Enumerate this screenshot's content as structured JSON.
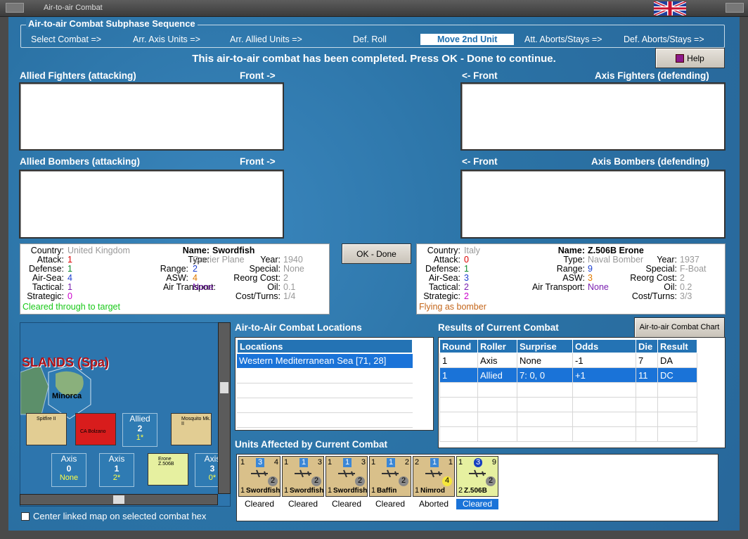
{
  "window": {
    "title": "Air-to-air Combat"
  },
  "subphase": {
    "title": "Air-to-air Combat Subphase Sequence",
    "phases": [
      "Select Combat =>",
      "Arr. Axis Units =>",
      "Arr. Allied Units =>",
      "Def. Roll",
      "Move 2nd Unit",
      "Att. Aborts/Stays =>",
      "Def. Aborts/Stays =>"
    ],
    "active_index": 4
  },
  "status_message": "This air-to-air combat has been completed.  Press OK - Done to continue.",
  "help_label": "Help",
  "panels": {
    "allied_fighters": {
      "label": "Allied Fighters (attacking)",
      "front": "Front ->"
    },
    "axis_fighters": {
      "label": "Axis Fighters (defending)",
      "front": "<- Front"
    },
    "allied_bombers": {
      "label": "Allied Bombers (attacking)",
      "front": "Front ->"
    },
    "axis_bombers": {
      "label": "Axis Bombers (defending)",
      "front": "<- Front"
    }
  },
  "ok_label": "OK - Done",
  "allied_unit": {
    "country_label": "Country:",
    "country": "United Kingdom",
    "name_label": "Name:",
    "name": "Swordfish",
    "attack_label": "Attack:",
    "attack": "1",
    "defense_label": "Defense:",
    "defense": "1",
    "airsea_label": "Air-Sea:",
    "airsea": "4",
    "tactical_label": "Tactical:",
    "tactical": "1",
    "strategic_label": "Strategic:",
    "strategic": "0",
    "type_label": "Type:",
    "type": "Carrier Plane",
    "year_label": "Year:",
    "year": "1940",
    "range_label": "Range:",
    "range": "2",
    "special_label": "Special:",
    "special": "None",
    "asw_label": "ASW:",
    "asw": "4",
    "reorg_label": "Reorg Cost:",
    "reorg": "2",
    "transport_label": "Air Transport:",
    "transport": "None",
    "oil_label": "Oil:",
    "oil": "0.1",
    "cost_label": "Cost/Turns:",
    "cost": "1/4",
    "status": "Cleared through to target"
  },
  "axis_unit": {
    "country_label": "Country:",
    "country": "Italy",
    "name_label": "Name:",
    "name": "Z.506B Erone",
    "attack_label": "Attack:",
    "attack": "0",
    "defense_label": "Defense:",
    "defense": "1",
    "airsea_label": "Air-Sea:",
    "airsea": "3",
    "tactical_label": "Tactical:",
    "tactical": "2",
    "strategic_label": "Strategic:",
    "strategic": "2",
    "type_label": "Type:",
    "type": "Naval Bomber",
    "year_label": "Year:",
    "year": "1937",
    "range_label": "Range:",
    "range": "9",
    "special_label": "Special:",
    "special": "F-Boat",
    "asw_label": "ASW:",
    "asw": "3",
    "reorg_label": "Reorg Cost:",
    "reorg": "2",
    "transport_label": "Air Transport:",
    "transport": "None",
    "oil_label": "Oil:",
    "oil": "0.2",
    "cost_label": "Cost/Turns:",
    "cost": "3/3",
    "status": "Flying as bomber"
  },
  "map": {
    "region_label": "SLANDS (Spa)",
    "hex_label": "Minorca",
    "boxes": [
      {
        "title": "Allied",
        "value": "2",
        "sub": "1*"
      },
      {
        "title": "Axis",
        "value": "0",
        "sub": "None"
      },
      {
        "title": "Axis",
        "value": "1",
        "sub": "2*"
      },
      {
        "title": "Axis",
        "value": "3",
        "sub": "0*"
      }
    ],
    "counter_names": [
      "Spitfire II",
      "CA Bolzano",
      "Mosquito Mk. II",
      "Erone Z.506B"
    ],
    "center_checkbox_label": "Center linked map on selected combat hex"
  },
  "locations": {
    "title": "Air-to-Air Combat Locations",
    "header": "Locations",
    "rows": [
      "Western Mediterranean Sea [71, 28]"
    ]
  },
  "results": {
    "title": "Results of Current Combat",
    "chart_button": "Air-to-air Combat Chart",
    "columns": [
      "Round",
      "Roller",
      "Surprise",
      "Odds",
      "Die",
      "Result"
    ],
    "rows": [
      [
        "1",
        "Axis",
        "None",
        "-1",
        "7",
        "DA"
      ],
      [
        "1",
        "Allied",
        "7: 0, 0",
        "+1",
        "11",
        "DC"
      ]
    ]
  },
  "affected": {
    "title": "Units Affected by Current Combat",
    "units": [
      {
        "name": "Swordfish",
        "status": "Cleared",
        "top": "3",
        "tl": "1",
        "tr": "4",
        "bl": "1",
        "br": "2"
      },
      {
        "name": "Swordfish",
        "status": "Cleared",
        "top": "1",
        "tl": "1",
        "tr": "3",
        "bl": "1",
        "br": "2"
      },
      {
        "name": "Swordfish",
        "status": "Cleared",
        "top": "1",
        "tl": "1",
        "tr": "3",
        "bl": "1",
        "br": "2"
      },
      {
        "name": "Baffin",
        "status": "Cleared",
        "top": "1",
        "tl": "1",
        "tr": "2",
        "bl": "1",
        "br": "2"
      },
      {
        "name": "Nimrod",
        "status": "Aborted",
        "top": "1",
        "tl": "2",
        "tr": "1",
        "bl": "1",
        "br": "4"
      },
      {
        "name": "Z.506B",
        "status": "Cleared",
        "top": "3",
        "tl": "1",
        "tr": "9",
        "bl": "2",
        "br": "2"
      }
    ]
  }
}
